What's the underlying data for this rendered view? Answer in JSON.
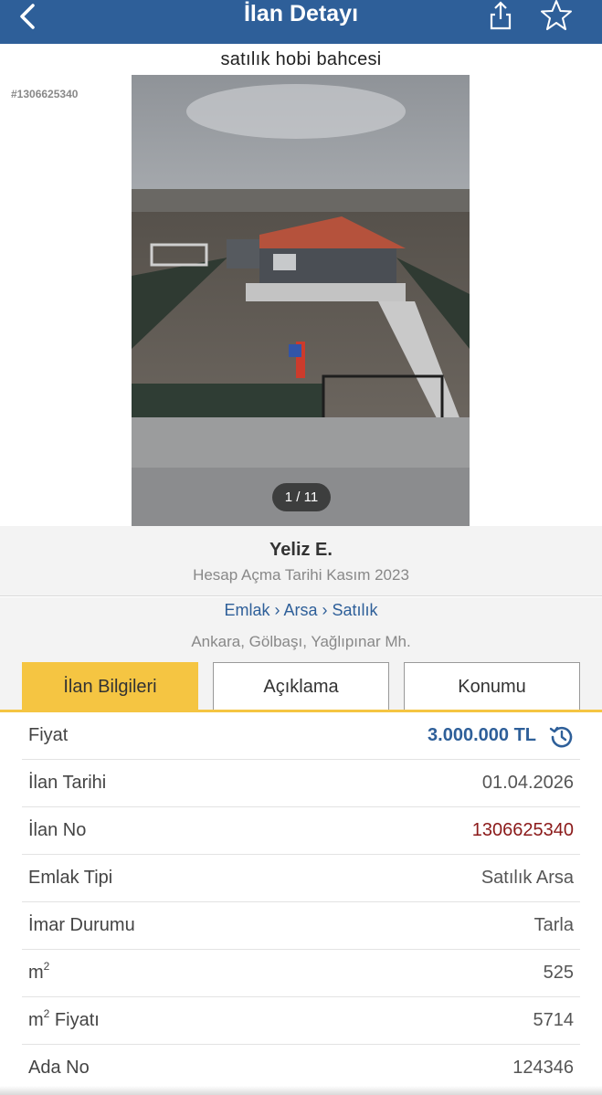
{
  "header": {
    "title": "İlan Detayı",
    "back_icon": "chevron-left-icon",
    "share_icon": "share-icon",
    "favorite_icon": "star-outline-icon",
    "bg_color": "#2e5f99"
  },
  "listing": {
    "subtitle": "satılık hobi bahcesi",
    "id_tag": "#1306625340",
    "photo_counter": "1 / 11"
  },
  "seller": {
    "name": "Yeliz E.",
    "since": "Hesap Açma Tarihi  Kasım 2023"
  },
  "breadcrumb": "Emlak › Arsa › Satılık",
  "location": "Ankara, Gölbaşı, Yağlıpınar Mh.",
  "tabs": [
    {
      "label": "İlan Bilgileri",
      "active": true
    },
    {
      "label": "Açıklama",
      "active": false
    },
    {
      "label": "Konumu",
      "active": false
    }
  ],
  "accent_color": "#f5c542",
  "details": {
    "price": {
      "label": "Fiyat",
      "value": "3.000.000 TL",
      "icon": "price-history-icon"
    },
    "date": {
      "label": "İlan Tarihi",
      "value": "01.04.2026"
    },
    "no": {
      "label": "İlan No",
      "value": "1306625340"
    },
    "type": {
      "label": "Emlak Tipi",
      "value": "Satılık Arsa"
    },
    "zoning": {
      "label": "İmar Durumu",
      "value": "Tarla"
    },
    "area": {
      "label": "m",
      "value": "525"
    },
    "area_price": {
      "label": "Fiyatı",
      "value": "5714"
    },
    "block": {
      "label": "Ada No",
      "value": "124346"
    }
  }
}
